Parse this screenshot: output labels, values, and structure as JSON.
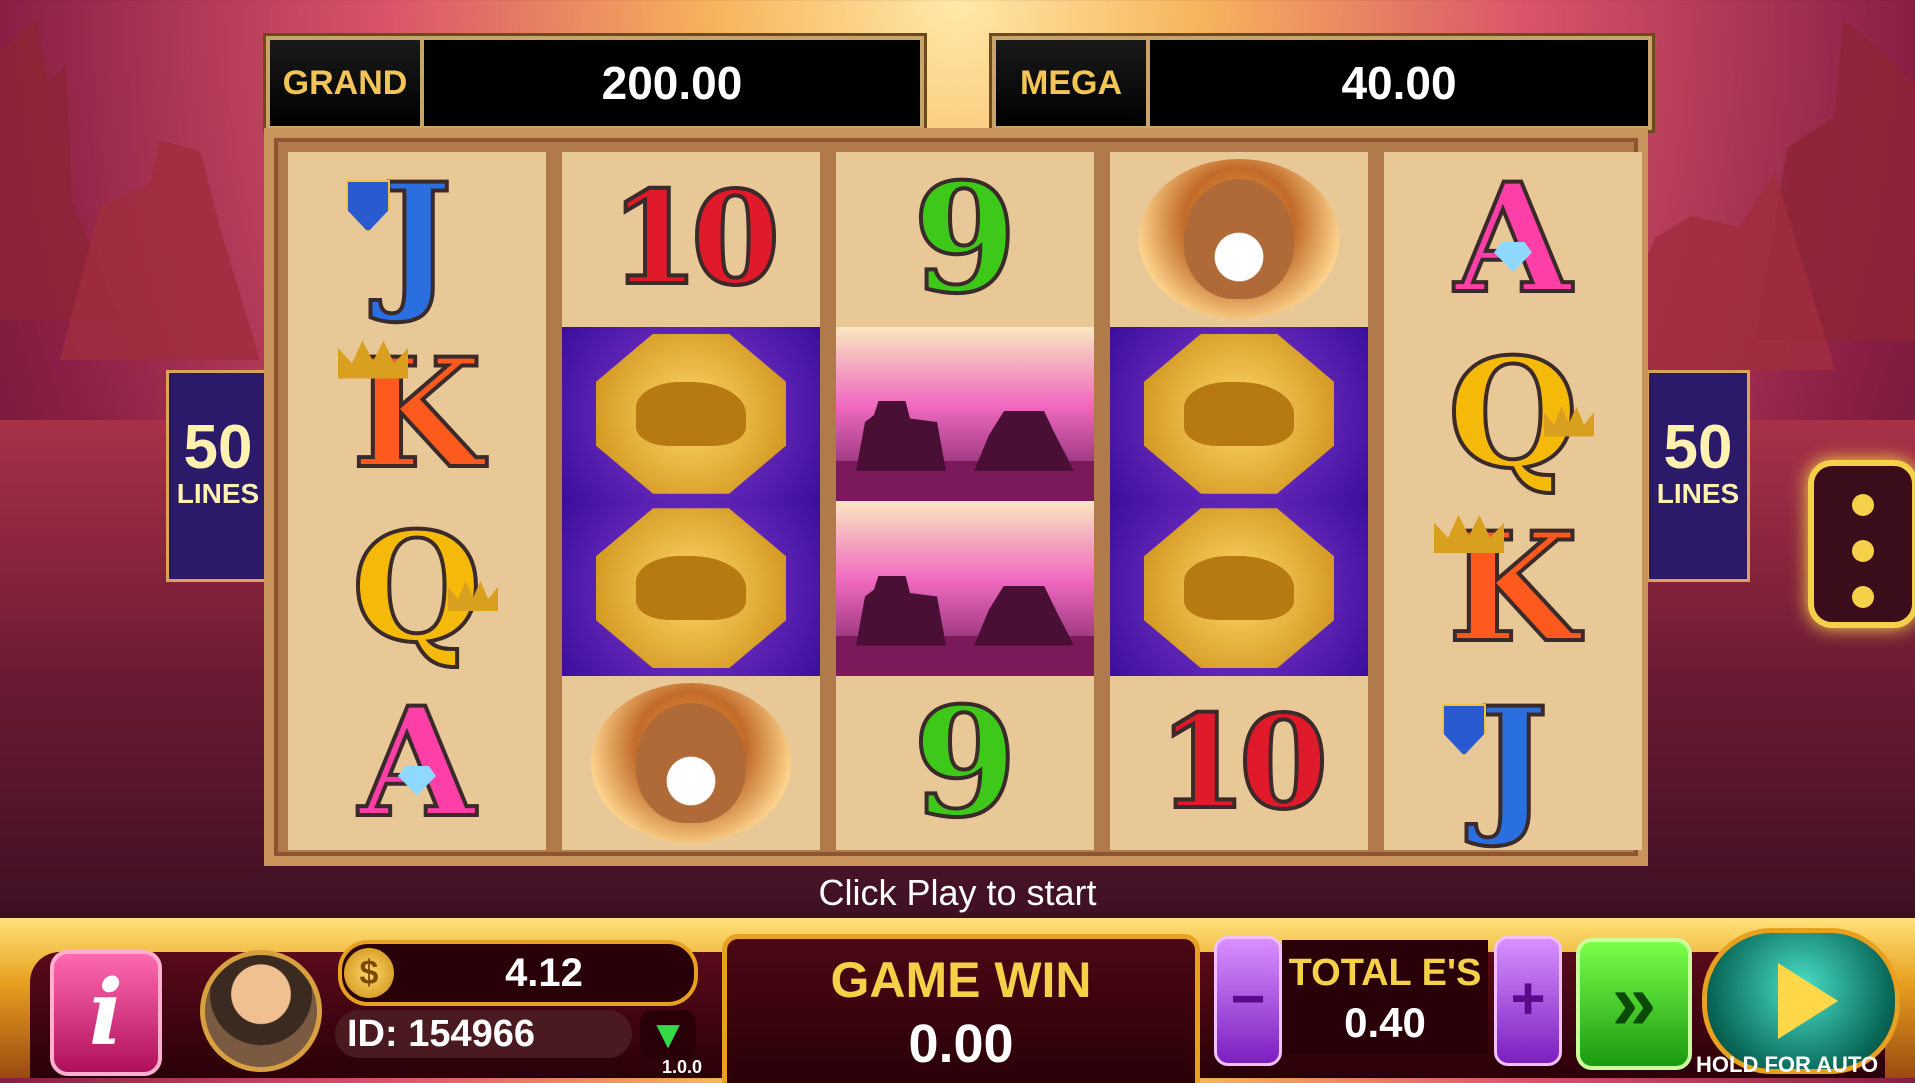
{
  "jackpots": {
    "grand": {
      "label": "GRAND",
      "value": "200.00"
    },
    "mega": {
      "label": "MEGA",
      "value": "40.00"
    }
  },
  "lines": {
    "count": "50",
    "label": "LINES"
  },
  "reels": [
    [
      "J",
      "K",
      "Q",
      "A"
    ],
    [
      "10",
      "buffalo-coin",
      "buffalo-coin",
      "lynx"
    ],
    [
      "9",
      "mesa-scatter",
      "mesa-scatter",
      "9"
    ],
    [
      "lynx",
      "buffalo-coin",
      "buffalo-coin",
      "10"
    ],
    [
      "A",
      "Q",
      "K",
      "J"
    ]
  ],
  "prompt": "Click Play to start",
  "bottom_bar": {
    "info_label": "i",
    "balance": "4.12",
    "coin_symbol": "$",
    "player_id": "ID: 154966",
    "version": "1.0.0",
    "game_win_label": "GAME WIN",
    "game_win_value": "0.00",
    "bet_label": "TOTAL E'S",
    "bet_value": "0.40",
    "minus_label": "−",
    "plus_label": "+",
    "turbo_label": "»",
    "hold_label": "HOLD FOR AUTO"
  }
}
